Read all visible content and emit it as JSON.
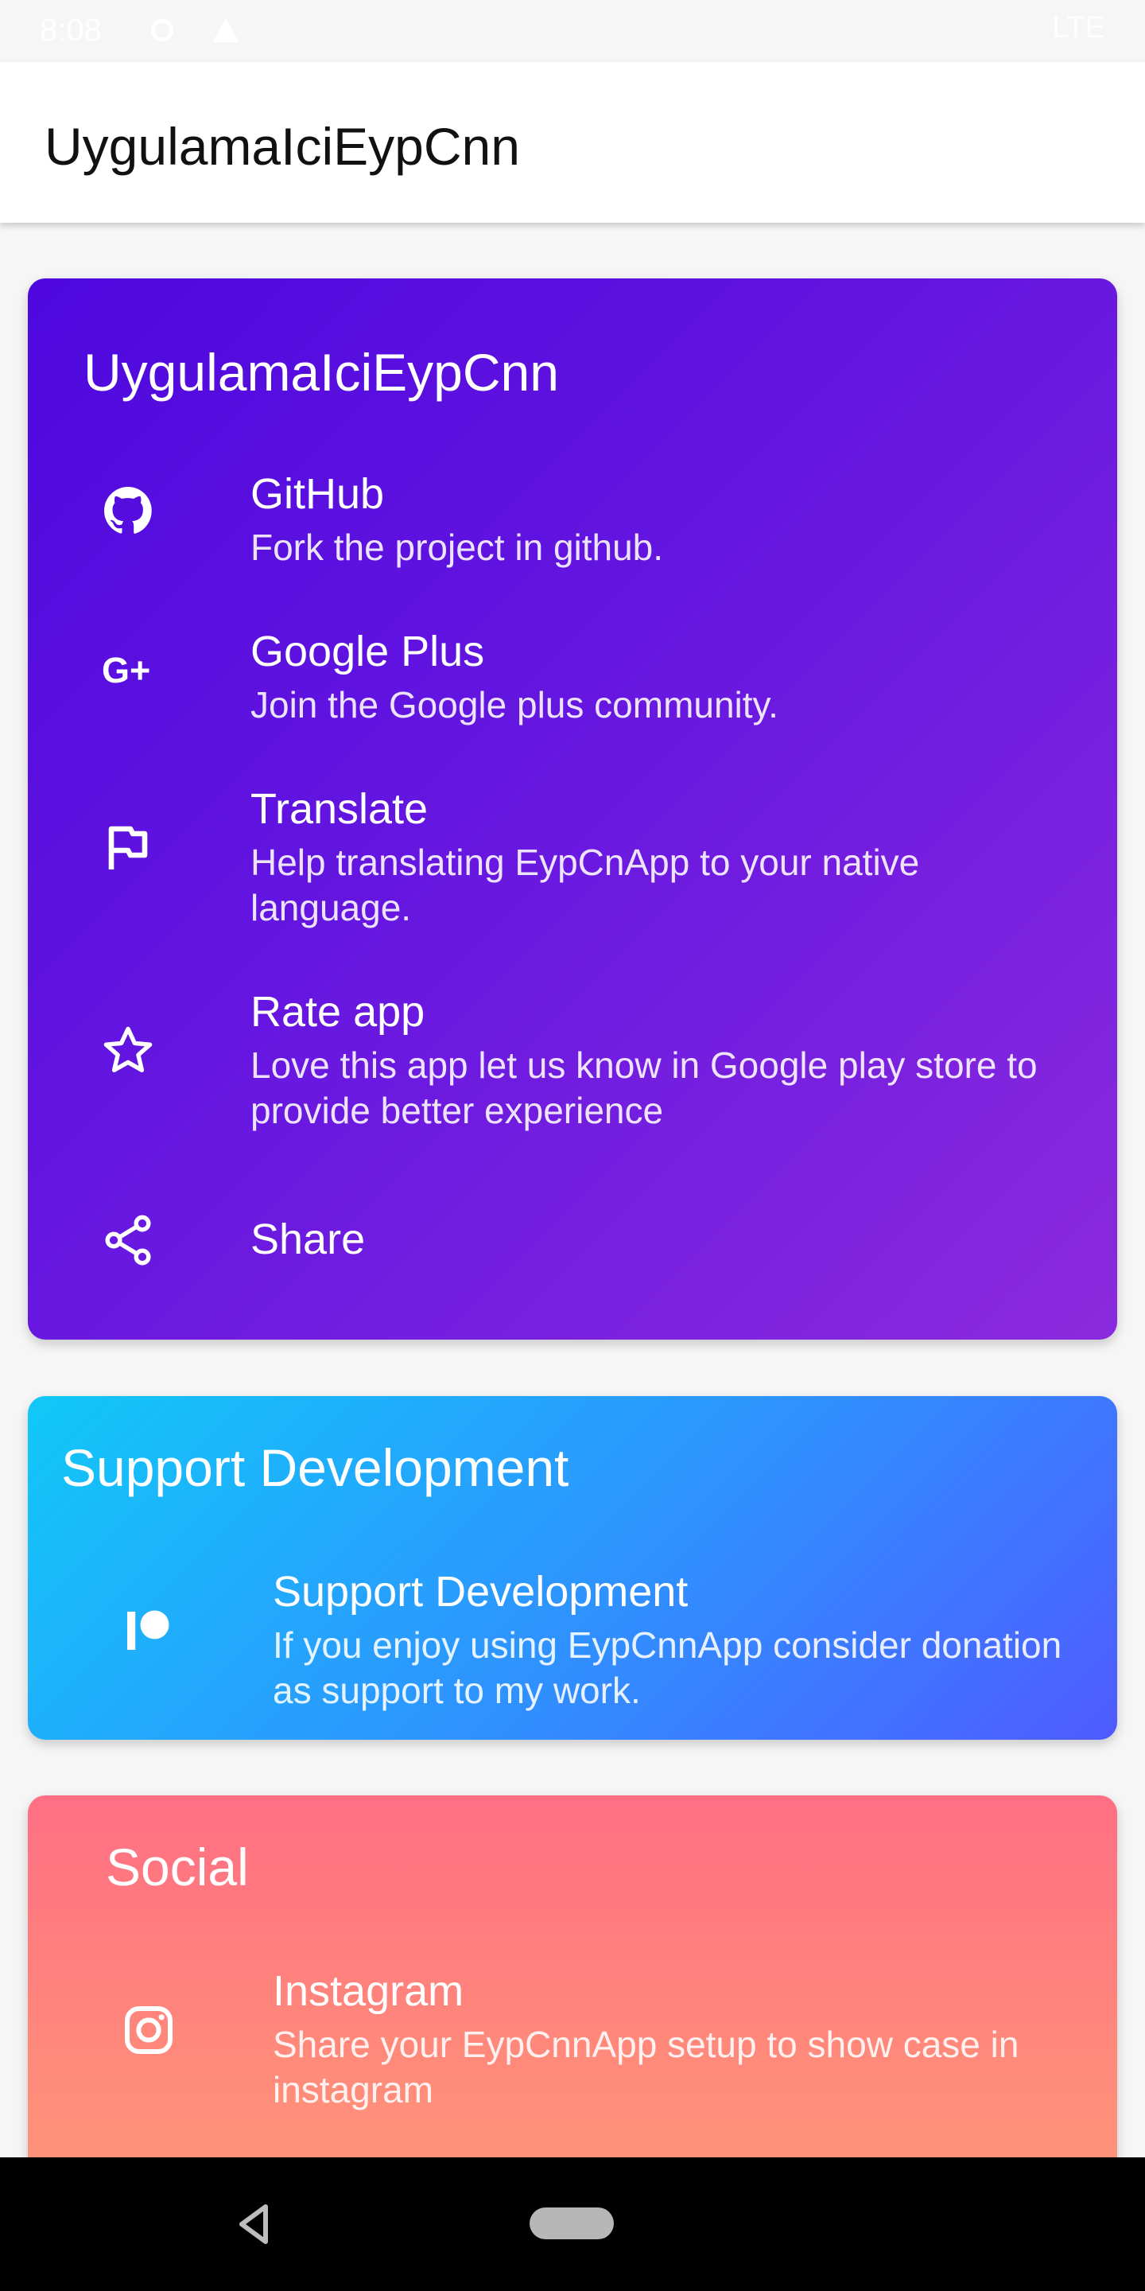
{
  "status_bar": {
    "time": "8:08",
    "network": "LTE"
  },
  "toolbar": {
    "title": "UygulamaIciEypCnn"
  },
  "about_card": {
    "title": "UygulamaIciEypCnn",
    "items": [
      {
        "title": "GitHub",
        "subtitle": "Fork the project in github.",
        "icon": "github-icon"
      },
      {
        "title": "Google Plus",
        "subtitle": "Join the Google plus community.",
        "icon": "google-plus-icon"
      },
      {
        "title": "Translate",
        "subtitle": "Help translating EypCnApp to your native language.",
        "icon": "flag-icon"
      },
      {
        "title": "Rate app",
        "subtitle": "Love this app let us know in Google play store to provide better experience",
        "icon": "star-icon"
      },
      {
        "title": "Share",
        "icon": "share-icon"
      }
    ]
  },
  "support_card": {
    "title": "Support Development",
    "items": [
      {
        "title": "Support Development",
        "subtitle": "If you enjoy using EypCnnApp consider donation as support to my work.",
        "icon": "patreon-icon"
      }
    ]
  },
  "social_card": {
    "title": "Social",
    "items": [
      {
        "title": "Instagram",
        "subtitle": "Share your EypCnnApp setup to show case in instagram",
        "icon": "instagram-icon"
      }
    ]
  },
  "colors": {
    "about_gradient": [
      "#4d08de",
      "#8b2ade"
    ],
    "support_gradient": [
      "#11c8f8",
      "#4f5bff"
    ],
    "social_gradient": [
      "#ff6f84",
      "#ff9a7c"
    ]
  }
}
